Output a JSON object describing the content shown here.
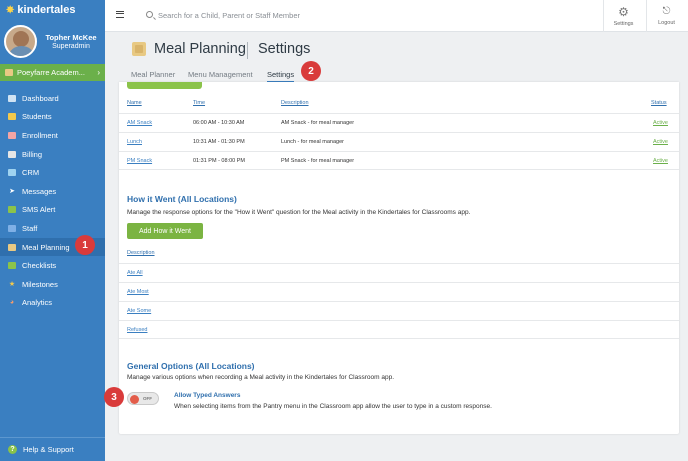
{
  "brand": "kindertales",
  "user": {
    "name": "Topher McKee",
    "role": "Superadmin"
  },
  "school": "Poeyfarre Academ...",
  "nav": [
    {
      "label": "Dashboard",
      "icon": "dashboard-icon",
      "color": "#d0e3f3"
    },
    {
      "label": "Students",
      "icon": "students-icon",
      "color": "#f2c94c"
    },
    {
      "label": "Enrollment",
      "icon": "enrollment-icon",
      "color": "#f2a5a5"
    },
    {
      "label": "Billing",
      "icon": "billing-icon",
      "color": "#e6e6e6"
    },
    {
      "label": "CRM",
      "icon": "crm-icon",
      "color": "#9fd3f0"
    },
    {
      "label": "Messages",
      "icon": "messages-icon",
      "color": "#ffffff"
    },
    {
      "label": "SMS Alert",
      "icon": "sms-alert-icon",
      "color": "#8bc34a"
    },
    {
      "label": "Staff",
      "icon": "staff-icon",
      "color": "#7fb0e6"
    },
    {
      "label": "Meal Planning",
      "icon": "meal-planning-icon",
      "color": "#e8c983"
    },
    {
      "label": "Checklists",
      "icon": "checklists-icon",
      "color": "#8bc34a"
    },
    {
      "label": "Milestones",
      "icon": "milestones-icon",
      "color": "#f2c94c"
    },
    {
      "label": "Analytics",
      "icon": "analytics-icon",
      "color": "#f29b6b"
    }
  ],
  "help": "Help & Support",
  "search": {
    "placeholder": "Search for a Child, Parent or Staff Member"
  },
  "topbar": {
    "settings": "Settings",
    "logout": "Logout"
  },
  "header": {
    "title": "Meal Planning",
    "subtitle": "Settings"
  },
  "tabs": [
    "Meal Planner",
    "Menu Management",
    "Settings"
  ],
  "meal_table": {
    "headers": {
      "name": "Name",
      "time": "Time",
      "description": "Description",
      "status": "Status"
    },
    "rows": [
      {
        "name": "AM Snack",
        "time": "06:00 AM - 10:30 AM",
        "description": "AM Snack - for meal manager",
        "status": "Active"
      },
      {
        "name": "Lunch",
        "time": "10:31 AM - 01:30 PM",
        "description": "Lunch - for meal manager",
        "status": "Active"
      },
      {
        "name": "PM Snack",
        "time": "01:31 PM - 08:00 PM",
        "description": "PM Snack - for meal manager",
        "status": "Active"
      }
    ]
  },
  "how_it_went": {
    "title": "How it Went (All Locations)",
    "description": "Manage the response options for the \"How it Went\" question for the Meal activity in the Kindertales for Classrooms app.",
    "button": "Add How it Went",
    "column": "Description",
    "items": [
      "Ate All",
      "Ate Most",
      "Ate Some",
      "Refused"
    ]
  },
  "general": {
    "title": "General Options (All Locations)",
    "description": "Manage various options when recording a Meal activity in the Kindertales for Classroom app.",
    "toggle_state": "OFF",
    "option_title": "Allow Typed Answers",
    "option_desc": "When selecting items from the Pantry menu in the Classroom app allow the user to type in a custom response."
  },
  "callouts": [
    "1",
    "2",
    "3"
  ],
  "colors": {
    "sidebar": "#3a7fc1",
    "accent_green": "#7bb442",
    "link": "#3a7fc1",
    "callout": "#d93b3b"
  }
}
